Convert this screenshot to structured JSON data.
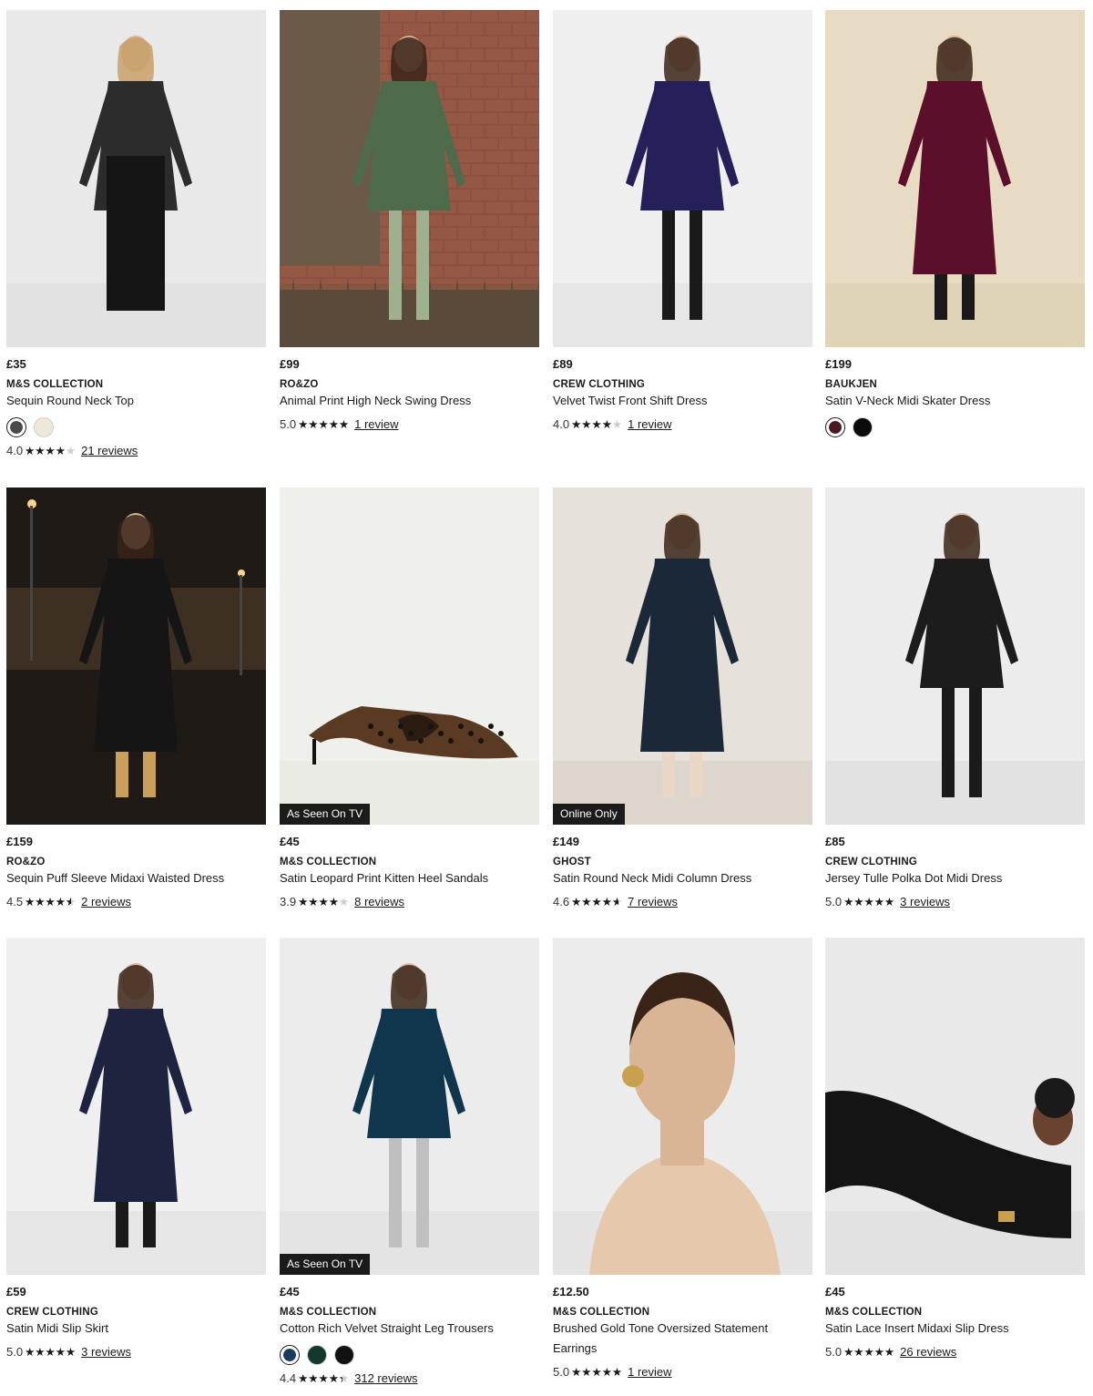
{
  "products": [
    {
      "price": "£35",
      "brand": "M&S COLLECTION",
      "name": "Sequin Round Neck Top",
      "badge": "",
      "swatches": [
        {
          "color": "#4a4a4a",
          "selected": true
        },
        {
          "color": "#ede8d9",
          "selected": false
        }
      ],
      "rating": "4.0",
      "stars": 0.8,
      "reviews": "21 reviews"
    },
    {
      "price": "£99",
      "brand": "RO&ZO",
      "name": "Animal Print High Neck Swing Dress",
      "badge": "",
      "swatches": [],
      "rating": "5.0",
      "stars": 1.0,
      "reviews": "1 review"
    },
    {
      "price": "£89",
      "brand": "CREW CLOTHING",
      "name": "Velvet Twist Front Shift Dress",
      "badge": "",
      "swatches": [],
      "rating": "4.0",
      "stars": 0.8,
      "reviews": "1 review"
    },
    {
      "price": "£199",
      "brand": "BAUKJEN",
      "name": "Satin V-Neck Midi Skater Dress",
      "badge": "",
      "swatches": [
        {
          "color": "#4a1a22",
          "selected": true
        },
        {
          "color": "#0a0a0a",
          "selected": false
        }
      ],
      "rating": "",
      "stars": 0,
      "reviews": ""
    },
    {
      "price": "£159",
      "brand": "RO&ZO",
      "name": "Sequin Puff Sleeve Midaxi Waisted Dress",
      "badge": "",
      "swatches": [],
      "rating": "4.5",
      "stars": 0.9,
      "reviews": "2 reviews"
    },
    {
      "price": "£45",
      "brand": "M&S COLLECTION",
      "name": "Satin Leopard Print Kitten Heel Sandals",
      "badge": "As Seen On TV",
      "swatches": [],
      "rating": "3.9",
      "stars": 0.78,
      "reviews": "8 reviews"
    },
    {
      "price": "£149",
      "brand": "GHOST",
      "name": "Satin Round Neck Midi Column Dress",
      "badge": "Online Only",
      "swatches": [],
      "rating": "4.6",
      "stars": 0.92,
      "reviews": "7 reviews"
    },
    {
      "price": "£85",
      "brand": "CREW CLOTHING",
      "name": "Jersey Tulle Polka Dot Midi Dress",
      "badge": "",
      "swatches": [],
      "rating": "5.0",
      "stars": 1.0,
      "reviews": "3 reviews"
    },
    {
      "price": "£59",
      "brand": "CREW CLOTHING",
      "name": "Satin Midi Slip Skirt",
      "badge": "",
      "swatches": [],
      "rating": "5.0",
      "stars": 1.0,
      "reviews": "3 reviews"
    },
    {
      "price": "£45",
      "brand": "M&S COLLECTION",
      "name": "Cotton Rich Velvet Straight Leg Trousers",
      "badge": "As Seen On TV",
      "swatches": [
        {
          "color": "#1b3a5e",
          "selected": true
        },
        {
          "color": "#123830",
          "selected": false
        },
        {
          "color": "#111111",
          "selected": false
        }
      ],
      "rating": "4.4",
      "stars": 0.88,
      "reviews": "312 reviews"
    },
    {
      "price": "£12.50",
      "brand": "M&S COLLECTION",
      "name": "Brushed Gold Tone Oversized Statement Earrings",
      "badge": "",
      "swatches": [],
      "rating": "5.0",
      "stars": 1.0,
      "reviews": "1 review"
    },
    {
      "price": "£45",
      "brand": "M&S COLLECTION",
      "name": "Satin Lace Insert Midaxi Slip Dress",
      "badge": "",
      "swatches": [],
      "rating": "5.0",
      "stars": 1.0,
      "reviews": "26 reviews"
    }
  ],
  "images": [
    {
      "bg": "#e9e9e9",
      "floor": "#e2e2e2",
      "garment": "#2c2c2c",
      "accent": "#6a6a6a",
      "icon": "sequin-top-photo-icon"
    },
    {
      "bg": "#8a5040",
      "floor": "#5a4a3a",
      "garment": "#4e6b4c",
      "accent": "#9fb08f",
      "icon": "swing-dress-photo-icon"
    },
    {
      "bg": "#efefef",
      "floor": "#e6e6e6",
      "garment": "#26205a",
      "accent": "#1a1a1a",
      "icon": "shift-dress-photo-icon"
    },
    {
      "bg": "#e7dcc3",
      "floor": "#dfd3b8",
      "garment": "#5c0f2a",
      "accent": "#1a1a1a",
      "icon": "skater-dress-photo-icon"
    },
    {
      "bg": "#2a211c",
      "floor": "#3a332e",
      "garment": "#151515",
      "accent": "#c9a05a",
      "icon": "sequin-dress-photo-icon"
    },
    {
      "bg": "#efefeb",
      "floor": "#ebebe6",
      "garment": "#5a3a22",
      "accent": "#1a1a1a",
      "icon": "leopard-heel-photo-icon"
    },
    {
      "bg": "#e6e1da",
      "floor": "#dcd6cc",
      "garment": "#1b2838",
      "accent": "#e8d7c4",
      "icon": "column-dress-photo-icon"
    },
    {
      "bg": "#ececec",
      "floor": "#e2e2e2",
      "garment": "#1c1c1c",
      "accent": "#1a1a1a",
      "icon": "polka-dress-photo-icon"
    },
    {
      "bg": "#efefef",
      "floor": "#e6e6e6",
      "garment": "#1e2440",
      "accent": "#1a1a1a",
      "icon": "slip-skirt-photo-icon"
    },
    {
      "bg": "#ececec",
      "floor": "#e4e4e4",
      "garment": "#10364e",
      "accent": "#bfbfbf",
      "icon": "velvet-trousers-photo-icon"
    },
    {
      "bg": "#ececec",
      "floor": "#e4e4e4",
      "garment": "#e6c8ad",
      "accent": "#c9a04b",
      "icon": "earrings-photo-icon"
    },
    {
      "bg": "#e9e9e9",
      "floor": "#e2e2e2",
      "garment": "#141414",
      "accent": "#c9a04b",
      "icon": "lace-slip-dress-photo-icon"
    }
  ],
  "colors": {
    "text": "#1a1a1a",
    "badge_bg": "#1b1b1b",
    "star_on": "#1a1a1a",
    "star_off": "#cdcdcd"
  }
}
